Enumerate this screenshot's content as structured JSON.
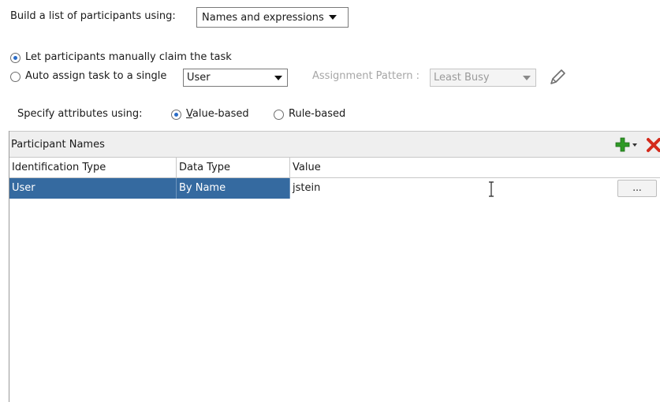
{
  "builder": {
    "label": "Build a list of participants using:",
    "select_value": "Names and expressions"
  },
  "assignment": {
    "manual_claim_label": "Let participants manually claim the task",
    "auto_assign_label": "Auto assign task to a single",
    "auto_assign_value": "User",
    "pattern_label": "Assignment Pattern :",
    "pattern_value": "Least Busy"
  },
  "attributes": {
    "label": "Specify attributes using:",
    "value_based": "Value-based",
    "value_based_rest": "alue-based",
    "value_based_mnemonic": "V",
    "rule_based": "Rule-based"
  },
  "participants": {
    "title": "Participant Names",
    "columns": [
      "Identification Type",
      "Data Type",
      "Value"
    ],
    "rows": [
      {
        "identification_type": "User",
        "data_type": "By Name",
        "value": "jstein"
      }
    ],
    "ellipsis": "..."
  },
  "colors": {
    "selection": "#356aa0",
    "add_icon": "#2f9a26",
    "delete_icon": "#d42a1c"
  },
  "icons": [
    "dropdown-arrow-icon",
    "pencil-icon",
    "add-icon",
    "delete-icon",
    "text-cursor-icon"
  ]
}
